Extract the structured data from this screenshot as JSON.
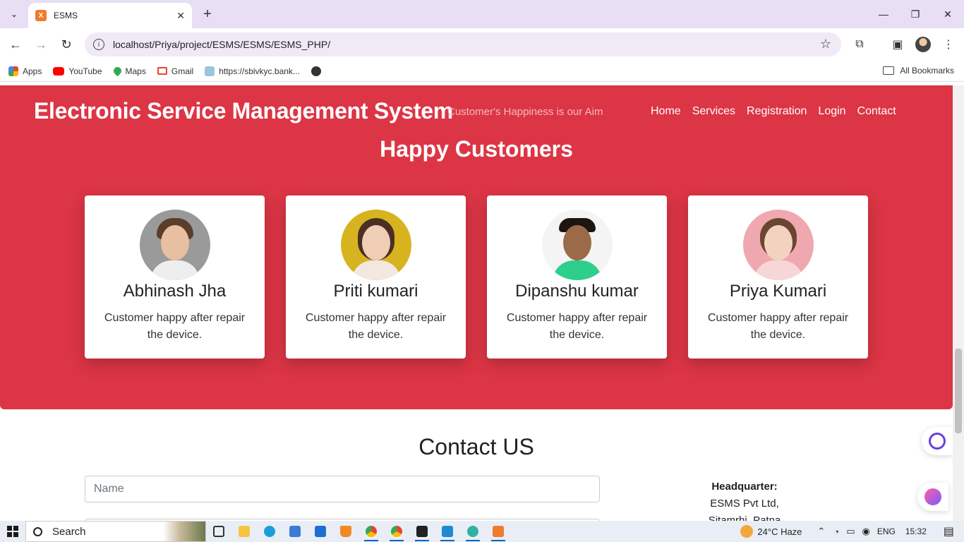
{
  "browser": {
    "tab_title": "ESMS",
    "tab_favicon": "X",
    "url": "localhost/Priya/project/ESMS/ESMS/ESMS_PHP/",
    "bookmarks": [
      "Apps",
      "YouTube",
      "Maps",
      "Gmail",
      "https://sbivkyc.bank..."
    ],
    "all_bookmarks": "All Bookmarks"
  },
  "site": {
    "brand": "Electronic Service Management System",
    "tagline": "Customer's Happiness is our Aim",
    "nav": [
      "Home",
      "Services",
      "Registration",
      "Login",
      "Contact"
    ],
    "happy_title": "Happy Customers",
    "customers": [
      {
        "name": "Abhinash Jha",
        "text": "Customer happy after repair the device."
      },
      {
        "name": "Priti kumari",
        "text": "Customer happy after repair the device."
      },
      {
        "name": "Dipanshu kumar",
        "text": "Customer happy after repair the device."
      },
      {
        "name": "Priya Kumari",
        "text": "Customer happy after repair the device."
      }
    ],
    "contact_title": "Contact US",
    "name_placeholder": "Name",
    "hq_label": "Headquarter:",
    "hq_line1": "ESMS Pvt Ltd,",
    "hq_line2": "Sitamrhi, Patna"
  },
  "taskbar": {
    "search": "Search",
    "weather": "24°C  Haze",
    "lang": "ENG",
    "time": "15:32"
  },
  "colors": {
    "hero_red": "#dc3545",
    "chrome_tab_bg": "#e8dff5"
  }
}
